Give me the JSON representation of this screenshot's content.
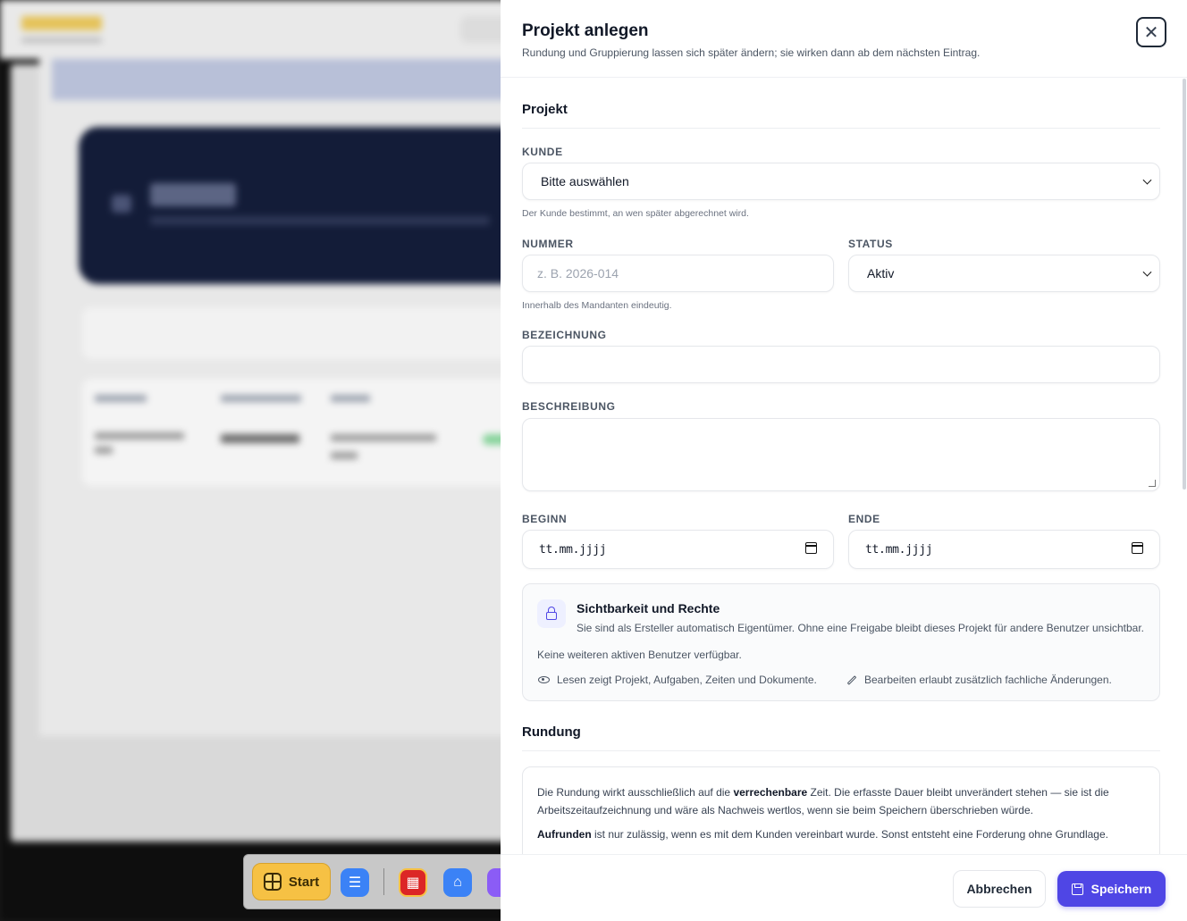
{
  "drawer": {
    "title": "Projekt anlegen",
    "subtitle": "Rundung und Gruppierung lassen sich später ändern; sie wirken dann ab dem nächsten Eintrag.",
    "close_symbol": "✕"
  },
  "project_section": {
    "title": "Projekt",
    "customer_label": "KUNDE",
    "customer_value": "Bitte auswählen",
    "customer_hint": "Der Kunde bestimmt, an wen später abgerechnet wird.",
    "number_label": "NUMMER",
    "number_placeholder": "z. B. 2026-014",
    "number_hint": "Innerhalb des Mandanten eindeutig.",
    "status_label": "STATUS",
    "status_value": "Aktiv",
    "name_label": "BEZEICHNUNG",
    "name_value": "",
    "description_label": "BESCHREIBUNG",
    "description_value": "",
    "start_label": "BEGINN",
    "start_value": "tt.mm.jjjj",
    "end_label": "ENDE",
    "end_value": "tt.mm.jjjj"
  },
  "permissions": {
    "title": "Sichtbarkeit und Rechte",
    "description": "Sie sind als Ersteller automatisch Eigentümer. Ohne eine Freigabe bleibt dieses Projekt für andere Benutzer unsichtbar.",
    "no_users": "Keine weiteren aktiven Benutzer verfügbar.",
    "read_legend": "Lesen zeigt Projekt, Aufgaben, Zeiten und Dokumente.",
    "edit_legend": "Bearbeiten erlaubt zusätzlich fachliche Änderungen."
  },
  "rounding": {
    "title": "Rundung",
    "p1_start": "Die Rundung wirkt ausschließlich auf die ",
    "p1_bold": "verrechenbare",
    "p1_end": " Zeit. Die erfasste Dauer bleibt unverändert stehen — sie ist die Arbeitszeitaufzeichnung und wäre als Nachweis wertlos, wenn sie beim Speichern überschrieben würde.",
    "p2_bold": "Aufrunden",
    "p2_end": " ist nur zulässig, wenn es mit dem Kunden vereinbart wurde. Sonst entsteht eine Forderung ohne Grundlage."
  },
  "footer": {
    "cancel_label": "Abbrechen",
    "save_label": "Speichern"
  },
  "taskbar": {
    "start_label": "Start",
    "icons": [
      "sliders-icon",
      "calendar-app-icon",
      "home-icon",
      "users-icon"
    ]
  },
  "colors": {
    "accent": "#4f46e5",
    "start_button": "#f6c144",
    "hero_background": "#131c38"
  }
}
